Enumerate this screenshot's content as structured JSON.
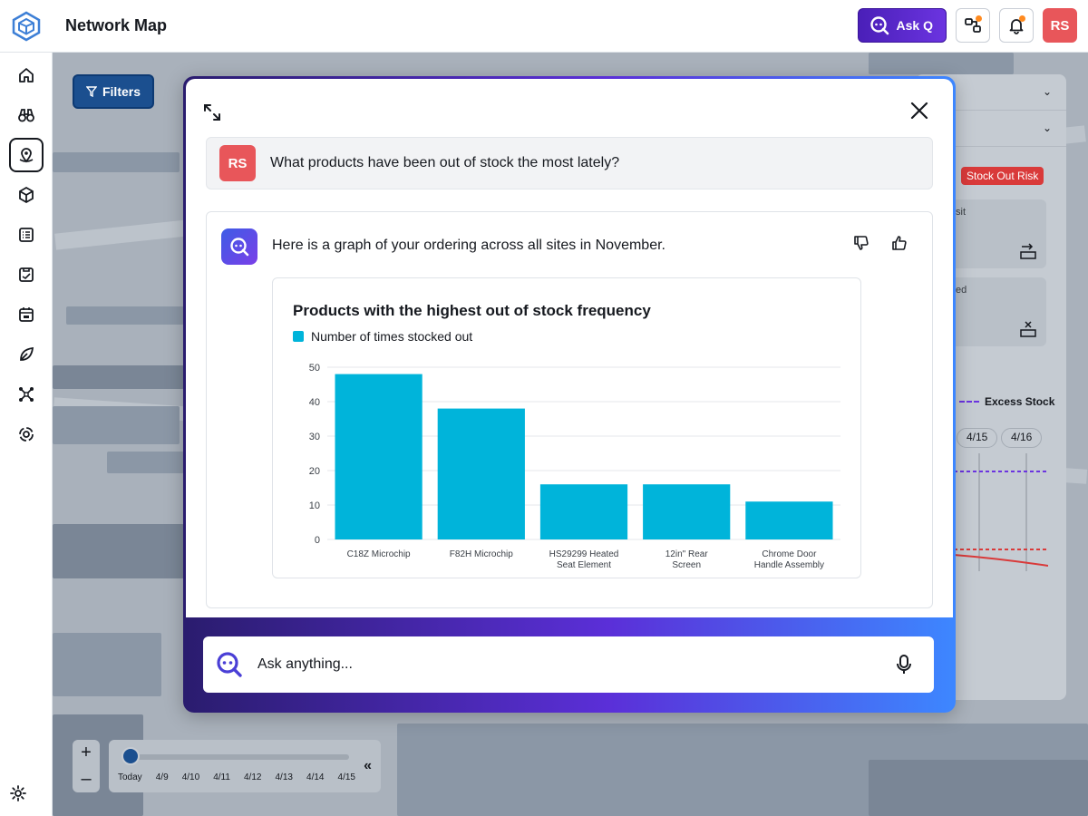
{
  "header": {
    "title": "Network Map",
    "ask_q_label": "Ask Q",
    "avatar_initials": "RS"
  },
  "sidebar": {
    "items": [
      {
        "name": "home-icon"
      },
      {
        "name": "binoculars-icon"
      },
      {
        "name": "map-pin-icon",
        "active": true
      },
      {
        "name": "box-icon"
      },
      {
        "name": "list-icon"
      },
      {
        "name": "clipboard-icon"
      },
      {
        "name": "calendar-icon"
      },
      {
        "name": "leaf-icon"
      },
      {
        "name": "network-icon"
      },
      {
        "name": "target-icon"
      }
    ],
    "settings_icon": "gear-icon"
  },
  "map": {
    "filters_label": "Filters",
    "risk_badge": "Stock Out Risk",
    "card1_text": "sit",
    "card2_text": "ed",
    "legend_excess": "Excess Stock",
    "date_tabs": [
      "4/15",
      "4/16"
    ],
    "timeline_labels": [
      "Today",
      "4/9",
      "4/10",
      "4/11",
      "4/12",
      "4/13",
      "4/14",
      "4/15"
    ]
  },
  "modal": {
    "question_avatar": "RS",
    "question": "What products have been out of stock the most lately?",
    "answer_text": "Here is a graph of your ordering across all sites in November.",
    "input_placeholder": "Ask anything..."
  },
  "chart_data": {
    "type": "bar",
    "title": "Products with the highest out of stock frequency",
    "legend": "Number of times stocked out",
    "categories": [
      "C18Z Microchip",
      "F82H Microchip",
      "HS29299 Heated Seat Element",
      "12in\" Rear Screen",
      "Chrome Door Handle Assembly"
    ],
    "values": [
      48,
      38,
      16,
      16,
      11
    ],
    "ylim": [
      0,
      50
    ],
    "yticks": [
      0,
      10,
      20,
      30,
      40,
      50
    ],
    "color": "#00b4da",
    "grid": true
  },
  "colors": {
    "accent": "#6b34e0",
    "brand_blue": "#1b4f8f",
    "bar": "#00b4da",
    "avatar": "#e8565a"
  }
}
